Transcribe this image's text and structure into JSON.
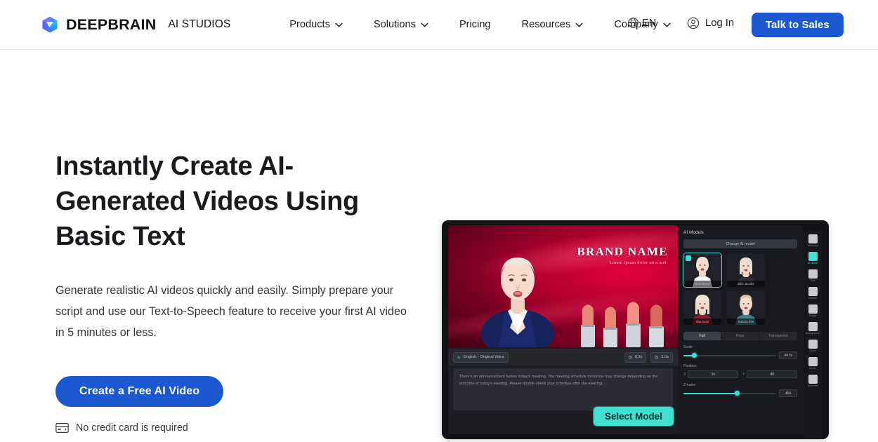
{
  "header": {
    "brand": {
      "name": "DEEPBRAIN",
      "sub": "AI STUDIOS",
      "logo_icon": "cube-logo-icon"
    },
    "nav": [
      {
        "label": "Products",
        "has_caret": true
      },
      {
        "label": "Solutions",
        "has_caret": true
      },
      {
        "label": "Pricing",
        "has_caret": false
      },
      {
        "label": "Resources",
        "has_caret": true
      },
      {
        "label": "Company",
        "has_caret": true
      }
    ],
    "language": {
      "label": "EN",
      "icon": "globe-icon"
    },
    "login": {
      "label": "Log In",
      "icon": "user-circle-icon"
    },
    "cta": {
      "label": "Talk to Sales",
      "color": "#1c58cf"
    }
  },
  "hero": {
    "title": "Instantly Create AI-Generated Videos Using Basic Text",
    "description": "Generate realistic AI videos quickly and easily. Simply prepare your script and use our Text-to-Speech feature to receive your first AI video in 5 minutes or less.",
    "primary_cta": {
      "label": "Create a Free AI Video",
      "color": "#1c58cf"
    },
    "note": {
      "label": "No credit card is required",
      "icon": "credit-card-icon"
    }
  },
  "app_preview": {
    "video": {
      "brand_title": "BRAND NAME",
      "brand_subtitle": "Lorem ipsum dolor sit a met"
    },
    "sub_bar": {
      "language_chip": "English - Original Voice",
      "duration_chip": "0.3s",
      "total_chip": "1.0s"
    },
    "script_text": "There's an announcement before today's meeting. The meeting schedule tomorrow may change depending on the outcome of today's meeting. Please double-check your schedule after the meeting.",
    "select_model_button": {
      "label": "Select Model",
      "color": "#3fe0d0"
    },
    "model_panel": {
      "title": "AI Models",
      "change_button": "Change AI model",
      "models": [
        {
          "name": "Nora Bruce",
          "selected": true
        },
        {
          "name": "Ellie Jacobs",
          "selected": false
        },
        {
          "name": "Mia Scott",
          "selected": false
        },
        {
          "name": "Sandra Kim",
          "selected": false
        }
      ],
      "tabs": [
        {
          "label": "Full",
          "active": true
        },
        {
          "label": "Pose",
          "active": false
        },
        {
          "label": "Transparent",
          "active": false
        }
      ],
      "controls": [
        {
          "label": "Scale",
          "value": "44 %",
          "fill_pct": 11
        },
        {
          "label": "Position",
          "x": "34",
          "y": "48"
        },
        {
          "label": "Z-index",
          "value": "404",
          "fill_pct": 58
        }
      ]
    },
    "toolbar": [
      {
        "label": "Template",
        "icon": "template-icon",
        "active": false
      },
      {
        "label": "AI Model",
        "icon": "ai-model-icon",
        "active": true
      },
      {
        "label": "Text",
        "icon": "text-icon",
        "active": false
      },
      {
        "label": "Subtitle",
        "icon": "subtitle-icon",
        "active": false
      },
      {
        "label": "Image",
        "icon": "image-icon",
        "active": false
      },
      {
        "label": "Background",
        "icon": "background-icon",
        "active": false
      },
      {
        "label": "Video",
        "icon": "video-icon",
        "active": false
      },
      {
        "label": "Audio",
        "icon": "audio-icon",
        "active": false
      },
      {
        "label": "Element",
        "icon": "element-icon",
        "active": false
      }
    ]
  }
}
